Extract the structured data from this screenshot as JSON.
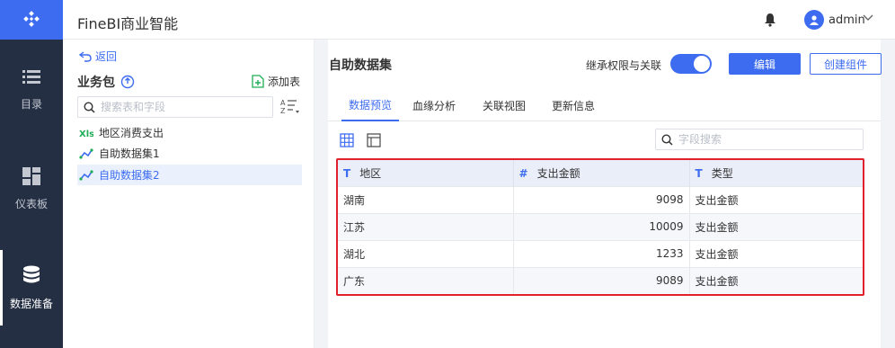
{
  "app": {
    "title": "FineBI商业智能"
  },
  "user": {
    "name": "admin"
  },
  "leftnav": [
    {
      "label": "目录",
      "icon": "list-icon"
    },
    {
      "label": "仪表板",
      "icon": "dashboard-icon"
    },
    {
      "label": "数据准备",
      "icon": "database-icon",
      "active": true
    }
  ],
  "pkgpanel": {
    "back_label": "返回",
    "title": "业务包",
    "add_label": "添加表",
    "search_placeholder": "搜索表和字段",
    "items": [
      {
        "label": "地区消费支出",
        "icon": "excel-table-icon"
      },
      {
        "label": "自助数据集1",
        "icon": "self-dataset-icon"
      },
      {
        "label": "自助数据集2",
        "icon": "self-dataset-icon",
        "selected": true
      }
    ]
  },
  "main": {
    "title": "自助数据集",
    "inherit_label": "继承权限与关联",
    "edit_button": "编辑",
    "create_component_button": "创建组件",
    "tabs": [
      "数据预览",
      "血缘分析",
      "关联视图",
      "更新信息"
    ],
    "active_tab": 0,
    "field_search_placeholder": "字段搜索"
  },
  "table": {
    "columns": [
      {
        "type_icon": "T",
        "label": "地区"
      },
      {
        "type_icon": "#",
        "label": "支出金额"
      },
      {
        "type_icon": "T",
        "label": "类型"
      }
    ],
    "rows": [
      [
        "湖南",
        "9098",
        "支出金额"
      ],
      [
        "江苏",
        "10009",
        "支出金额"
      ],
      [
        "湖北",
        "1233",
        "支出金额"
      ],
      [
        "广东",
        "9089",
        "支出金额"
      ]
    ]
  },
  "colors": {
    "accent": "#3d6cf0",
    "nav_bg": "#242f43",
    "highlight_border": "#e0202a"
  }
}
